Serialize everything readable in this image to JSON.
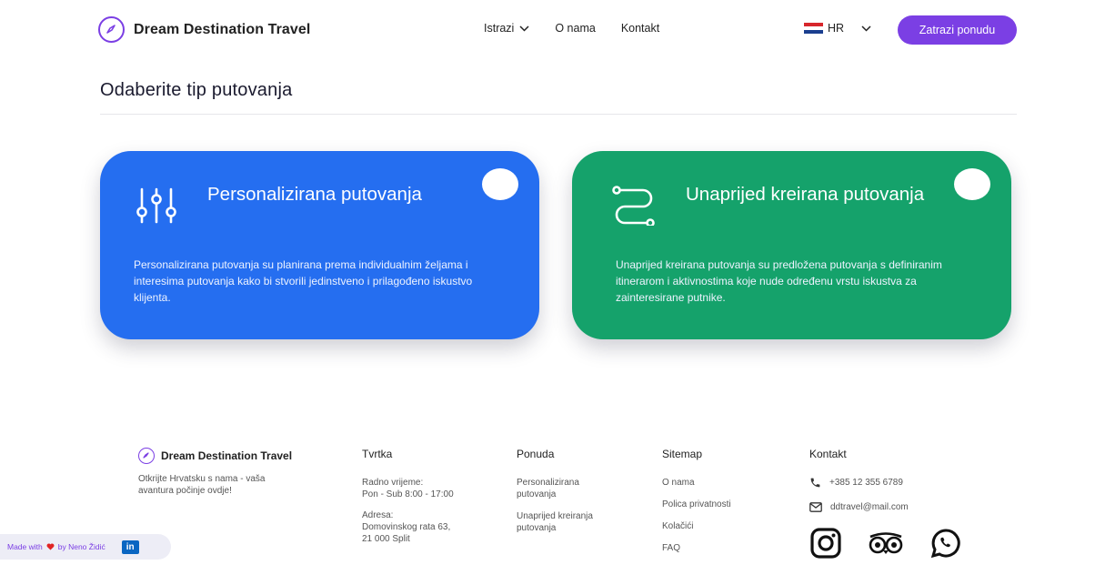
{
  "brand": {
    "name": "Dream Destination Travel"
  },
  "nav": {
    "explore": "Istrazi",
    "about": "O nama",
    "contact": "Kontakt"
  },
  "language": {
    "code": "HR"
  },
  "cta_label": "Zatrazi ponudu",
  "section_title": "Odaberite tip putovanja",
  "cards": [
    {
      "title": "Personalizirana putovanja",
      "description": "Personalizirana putovanja su planirana prema individualnim željama i interesima putovanja kako bi stvorili jedinstveno i prilagođeno iskustvo klijenta.",
      "color": "#256ef0",
      "icon": "sliders-icon"
    },
    {
      "title": "Unaprijed kreirana putovanja",
      "description": "Unaprijed kreirana putovanja su predložena putovanja s definiranim itinerarom i aktivnostima koje nude određenu vrstu iskustva za zainteresirane putnike.",
      "color": "#15a26b",
      "icon": "route-icon"
    }
  ],
  "footer": {
    "brand_name": "Dream Destination Travel",
    "tagline": "Otkrijte Hrvatsku s nama - vaša avantura počinje ovdje!",
    "tvrtka": {
      "heading": "Tvrtka",
      "hours_label": "Radno vrijeme:",
      "hours_value": "Pon - Sub 8:00 - 17:00",
      "address_label": "Adresa:",
      "address_line1": "Domovinskog rata 63,",
      "address_line2": "21 000 Split"
    },
    "ponuda": {
      "heading": "Ponuda",
      "links": [
        "Personalizirana putovanja",
        "Unaprijed kreiranja putovanja"
      ]
    },
    "sitemap": {
      "heading": "Sitemap",
      "links": [
        "O nama",
        "Polica privatnosti",
        "Kolačići",
        "FAQ"
      ]
    },
    "kontakt": {
      "heading": "Kontakt",
      "phone": "+385 12 355 6789",
      "email": "ddtravel@mail.com"
    }
  },
  "made_with": {
    "prefix": "Made with",
    "suffix": "by Neno Židić",
    "linkedin": "in"
  },
  "colors": {
    "accent": "#7b3fe4",
    "blue_card": "#256ef0",
    "green_card": "#15a26b"
  }
}
